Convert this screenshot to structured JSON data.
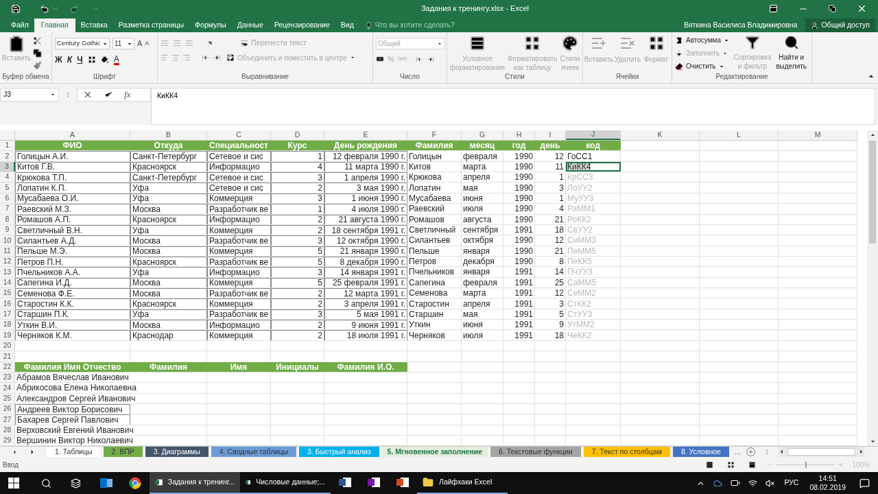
{
  "title_bar": {
    "title": "Задания к тренингу.xlsx - Excel"
  },
  "menu_tabs": [
    {
      "label": "Файл",
      "selected": false
    },
    {
      "label": "Главная",
      "selected": true
    },
    {
      "label": "Вставка",
      "selected": false
    },
    {
      "label": "Разметка страницы",
      "selected": false
    },
    {
      "label": "Формулы",
      "selected": false
    },
    {
      "label": "Данные",
      "selected": false
    },
    {
      "label": "Рецензирование",
      "selected": false
    },
    {
      "label": "Вид",
      "selected": false
    }
  ],
  "tell_me": {
    "placeholder": "Что вы хотите сделать?"
  },
  "user": "Вяткина Василиса Владимировна",
  "share": "Общий доступ",
  "ribbon": {
    "clipboard": {
      "label": "Буфер обмена",
      "paste": {
        "label": "Вставить",
        "disabled": true
      }
    },
    "font": {
      "label": "Шрифт",
      "font_name": "Century Gothic",
      "font_size": "11",
      "grow": "A",
      "shrink": "A",
      "bold": "Ж",
      "italic": "К",
      "underline": "Ч",
      "font_color": "A"
    },
    "alignment": {
      "label": "Выравнивание",
      "wrap": {
        "label": "Перенести текст",
        "disabled": true
      },
      "merge": {
        "label": "Объединить и поместить в центре",
        "disabled": true
      }
    },
    "number": {
      "label": "Число",
      "format": "Общий",
      "percent": "%",
      "thousands": "000"
    },
    "styles": {
      "label": "Стили",
      "items": [
        {
          "label": "Условное форматирование",
          "disabled": true
        },
        {
          "label": "Форматировать как таблицу",
          "disabled": true
        },
        {
          "label": "Стили ячеек",
          "disabled": true
        }
      ]
    },
    "cells": {
      "label": "Ячейки",
      "items": [
        {
          "label": "Вставить",
          "disabled": true
        },
        {
          "label": "Удалить",
          "disabled": true
        },
        {
          "label": "Формат",
          "disabled": true
        }
      ]
    },
    "editing": {
      "label": "Редактирование",
      "items": [
        {
          "kind": "small",
          "label": "Автосумма",
          "disabled": false
        },
        {
          "kind": "small",
          "label": "Заполнить",
          "disabled": true
        },
        {
          "kind": "small",
          "label": "Очистить",
          "disabled": false
        },
        {
          "kind": "large",
          "label": "Сортировка и фильтр",
          "disabled": true
        },
        {
          "kind": "large",
          "label": "Найти и выделить",
          "disabled": false
        }
      ]
    }
  },
  "formula_bar": {
    "name_box": "J3",
    "function_label": "fx",
    "formula": "КиКК4"
  },
  "columns": [
    {
      "label": "A",
      "selected": false
    },
    {
      "label": "B",
      "selected": false
    },
    {
      "label": "C",
      "selected": false
    },
    {
      "label": "D",
      "selected": false
    },
    {
      "label": "E",
      "selected": false
    },
    {
      "label": "F",
      "selected": false
    },
    {
      "label": "G",
      "selected": false
    },
    {
      "label": "H",
      "selected": false
    },
    {
      "label": "I",
      "selected": false
    },
    {
      "label": "J",
      "selected": true
    },
    {
      "label": "K",
      "selected": false
    },
    {
      "label": "L",
      "selected": false
    },
    {
      "label": "M",
      "selected": false
    }
  ],
  "rows": [
    {
      "number": "1",
      "header": true,
      "selected": false,
      "cells": [
        "ФИО",
        "Откуда",
        "Специальност",
        "Курс",
        "День рождения",
        "Фамилия",
        "месяц",
        "год",
        "день",
        "код"
      ]
    },
    {
      "number": "2",
      "header": false,
      "selected": false,
      "suggested": false,
      "cells": [
        "Голицын А.И.",
        "Санкт-Петербург",
        "Сетевое и сис",
        "1",
        "12 февраля 1990 г.",
        "Голицын",
        "февраля",
        "1990",
        "12",
        "ГоСС1"
      ]
    },
    {
      "number": "3",
      "header": false,
      "selected": true,
      "suggested": false,
      "cells": [
        "Китов Г.В.",
        "Красноярск",
        "Информацио",
        "4",
        "11 марта 1990 г.",
        "Китов",
        "марта",
        "1990",
        "11",
        "КиКК4"
      ]
    },
    {
      "number": "4",
      "header": false,
      "selected": false,
      "suggested": true,
      "cells": [
        "Крюкова Т.П.",
        "Санкт-Петербург",
        "Сетевое и сис",
        "3",
        "1 апреля 1990 г.",
        "Крюкова",
        "апреля",
        "1990",
        "1",
        "КрСС3"
      ]
    },
    {
      "number": "5",
      "header": false,
      "selected": false,
      "suggested": true,
      "cells": [
        "Лопатин К.П.",
        "Уфа",
        "Сетевое и сис",
        "2",
        "3 мая 1990 г.",
        "Лопатин",
        "мая",
        "1990",
        "3",
        "ЛоУУ2"
      ]
    },
    {
      "number": "6",
      "header": false,
      "selected": false,
      "suggested": true,
      "cells": [
        "Мусабаева О.И.",
        "Уфа",
        "Коммерция",
        "3",
        "1 июня 1990 г.",
        "Мусабаева",
        "июня",
        "1990",
        "1",
        "МуУУ3"
      ]
    },
    {
      "number": "7",
      "header": false,
      "selected": false,
      "suggested": true,
      "cells": [
        "Раевский М.З.",
        "Москва",
        "Разработчик ве",
        "1",
        "4 июля 1990 г.",
        "Раевский",
        "июля",
        "1990",
        "4",
        "РаММ1"
      ]
    },
    {
      "number": "8",
      "header": false,
      "selected": false,
      "suggested": true,
      "cells": [
        "Ромашов А.П.",
        "Красноярск",
        "Информацио",
        "2",
        "21 августа 1990 г.",
        "Ромашов",
        "августа",
        "1990",
        "21",
        "РоКК2"
      ]
    },
    {
      "number": "9",
      "header": false,
      "selected": false,
      "suggested": true,
      "cells": [
        "Светличный В.Н.",
        "Уфа",
        "Коммерция",
        "2",
        "18 сентября 1991 г.",
        "Светличный",
        "сентября",
        "1991",
        "18",
        "СвУУ2"
      ]
    },
    {
      "number": "10",
      "header": false,
      "selected": false,
      "suggested": true,
      "cells": [
        "Силантьев А.Д.",
        "Москва",
        "Разработчик ве",
        "3",
        "12 октября 1990 г.",
        "Силантьев",
        "октября",
        "1990",
        "12",
        "СиММ3"
      ]
    },
    {
      "number": "11",
      "header": false,
      "selected": false,
      "suggested": true,
      "cells": [
        "Пельше М.Э.",
        "Москва",
        "Коммерция",
        "5",
        "21 января 1990 г.",
        "Пельше",
        "января",
        "1990",
        "21",
        "ПеММ5"
      ]
    },
    {
      "number": "12",
      "header": false,
      "selected": false,
      "suggested": true,
      "cells": [
        "Петров П.Н.",
        "Красноярск",
        "Разработчик ве",
        "5",
        "8 декабря 1990 г.",
        "Петров",
        "декабря",
        "1990",
        "8",
        "ПеКК5"
      ]
    },
    {
      "number": "13",
      "header": false,
      "selected": false,
      "suggested": true,
      "cells": [
        "Пчельников А.А.",
        "Уфа",
        "Информацио",
        "3",
        "14 января 1991 г.",
        "Пчельников",
        "января",
        "1991",
        "14",
        "ПчУУ3"
      ]
    },
    {
      "number": "14",
      "header": false,
      "selected": false,
      "suggested": true,
      "cells": [
        "Сапегина И.Д.",
        "Москва",
        "Коммерция",
        "5",
        "25 февраля 1991 г.",
        "Сапегина",
        "февраля",
        "1991",
        "25",
        "СаММ5"
      ]
    },
    {
      "number": "15",
      "header": false,
      "selected": false,
      "suggested": true,
      "cells": [
        "Семенова Ф.Е.",
        "Москва",
        "Разработчик ве",
        "2",
        "12 марта 1991 г.",
        "Семенова",
        "марта",
        "1991",
        "12",
        "СеММ2"
      ]
    },
    {
      "number": "16",
      "header": false,
      "selected": false,
      "suggested": true,
      "cells": [
        "Старостин К.К.",
        "Красноярск",
        "Коммерция",
        "2",
        "3 апреля 1991 г.",
        "Старостин",
        "апреля",
        "1991",
        "3",
        "СтКК2"
      ]
    },
    {
      "number": "17",
      "header": false,
      "selected": false,
      "suggested": true,
      "cells": [
        "Старшин П.К.",
        "Уфа",
        "Разработчик ве",
        "3",
        "5 мая 1991 г.",
        "Старшин",
        "мая",
        "1991",
        "5",
        "СтУУ3"
      ]
    },
    {
      "number": "18",
      "header": false,
      "selected": false,
      "suggested": true,
      "cells": [
        "Уткин В.И.",
        "Москва",
        "Информацио",
        "2",
        "9 июня 1991 г.",
        "Уткин",
        "июня",
        "1991",
        "9",
        "УтММ2"
      ]
    },
    {
      "number": "19",
      "header": false,
      "selected": false,
      "suggested": true,
      "cells": [
        "Черняков К.М.",
        "Краснодар",
        "Коммерция",
        "2",
        "18 июля 1991 г.",
        "Черняков",
        "июля",
        "1991",
        "18",
        "ЧеКК2"
      ]
    },
    {
      "number": "20",
      "selected": false,
      "cells": []
    },
    {
      "number": "21",
      "selected": false,
      "cells": []
    },
    {
      "number": "22",
      "header": true,
      "selected": false,
      "cells": [
        "Фамилия Имя Отчество",
        "Фамилия",
        "Имя",
        "Инициалы",
        "Фамилия И.О."
      ]
    },
    {
      "number": "23",
      "header": false,
      "selected": false,
      "cells": [
        "Абрамов Вячеслав Иванович"
      ]
    },
    {
      "number": "24",
      "header": false,
      "selected": false,
      "cells": [
        "Абрикосова Елена Николаевна"
      ]
    },
    {
      "number": "25",
      "header": false,
      "selected": false,
      "cells": [
        "Александров Сергей Иванович"
      ]
    },
    {
      "number": "26",
      "header": false,
      "selected": false,
      "cells": [
        "Андреев Виктор Борисович"
      ]
    },
    {
      "number": "27",
      "header": false,
      "selected": false,
      "cells": [
        "Бахарев Сергей Павлович"
      ]
    },
    {
      "number": "28",
      "header": false,
      "selected": false,
      "cells": [
        "Верховский Евгений Иванович"
      ]
    },
    {
      "number": "29",
      "header": false,
      "selected": false,
      "cells": [
        "Вершинин Виктор Николаевич"
      ]
    }
  ],
  "sheet_tabs": [
    {
      "label": "1. Таблицы",
      "selected": false
    },
    {
      "label": "2. ВПР",
      "color": "#70ad47",
      "selected": false
    },
    {
      "label": "3. Диаграммы",
      "color": "#44546a",
      "selected": false
    },
    {
      "label": "4. Сводные таблицы",
      "color": "#6b9bd6",
      "selected": false
    },
    {
      "label": "3. Быстрый анализ",
      "color": "#00b0f0",
      "selected": false
    },
    {
      "label": "5. Мгновенное заполнение",
      "color": "#e2efda",
      "selected": true
    },
    {
      "label": "6. Текстовые функции",
      "color": "#a5a5a5",
      "selected": false
    },
    {
      "label": "7. Текст по столбцам",
      "color": "#ffc000",
      "selected": false
    },
    {
      "label": "8. Условное",
      "color": "#4472c4",
      "selected": false
    }
  ],
  "more_tabs": "...",
  "status_bar": {
    "mode": "Ввод",
    "zoom": "100%",
    "zoom_slider": {
      "level": 0.5
    }
  },
  "taskbar": {
    "apps": [
      {
        "kind": "spreadsheet",
        "label": "Задания к тренинг...",
        "selected": true
      },
      {
        "kind": "spreadsheet",
        "label": "Числовые данные;...",
        "selected": false
      },
      {
        "kind": "document",
        "selected": false
      },
      {
        "kind": "notes",
        "selected": false
      },
      {
        "kind": "slides",
        "selected": false
      },
      {
        "kind": "folder",
        "label": "Лайфхаки Excel",
        "selected": false
      }
    ],
    "language": "РУС",
    "time": "14:51",
    "date": "08.02.2019"
  }
}
